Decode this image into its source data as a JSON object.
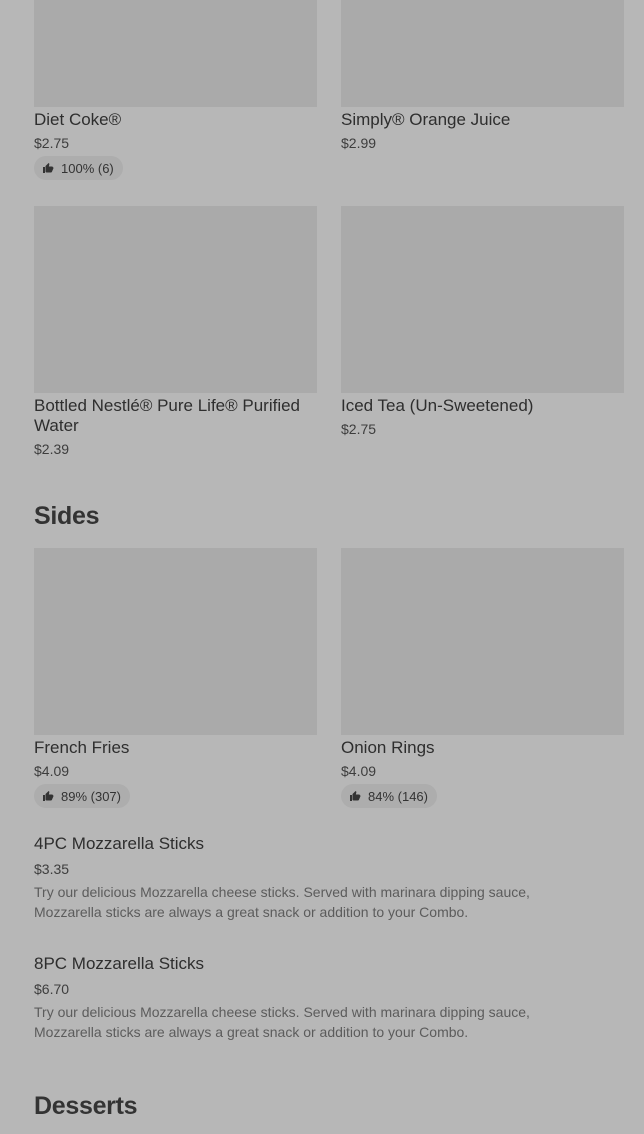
{
  "drinks": [
    {
      "name": "Diet Coke®",
      "price": "$2.75",
      "rating": "100% (6)"
    },
    {
      "name": "Simply® Orange Juice",
      "price": "$2.99"
    },
    {
      "name": "Bottled Nestlé® Pure Life® Purified Water",
      "price": "$2.39"
    },
    {
      "name": "Iced Tea (Un-Sweetened)",
      "price": "$2.75"
    }
  ],
  "sides": {
    "title": "Sides",
    "cards": [
      {
        "name": "French Fries",
        "price": "$4.09",
        "rating": "89% (307)"
      },
      {
        "name": "Onion Rings",
        "price": "$4.09",
        "rating": "84% (146)"
      }
    ],
    "list": [
      {
        "name": "4PC Mozzarella Sticks",
        "price": "$3.35",
        "description": "Try our delicious Mozzarella cheese sticks. Served with marinara dipping sauce, Mozzarella sticks are always a great snack or addition to your Combo."
      },
      {
        "name": "8PC Mozzarella Sticks",
        "price": "$6.70",
        "description": "Try our delicious Mozzarella cheese sticks. Served with marinara dipping sauce, Mozzarella sticks are always a great snack or addition to your Combo."
      }
    ]
  },
  "desserts": {
    "title": "Desserts"
  }
}
